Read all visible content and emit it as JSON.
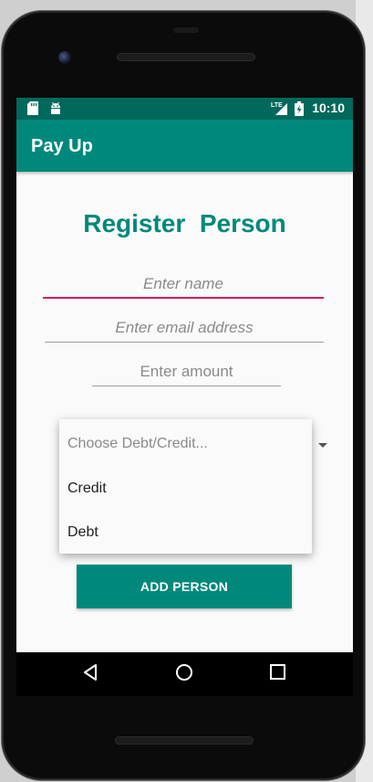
{
  "app": {
    "title": "Pay Up"
  },
  "status_bar": {
    "time": "10:10",
    "network": "LTE",
    "icons": [
      "sd-card-icon",
      "android-icon",
      "signal-icon",
      "battery-charging-icon"
    ]
  },
  "form": {
    "heading": "Register  Person",
    "name_placeholder": "Enter name",
    "email_placeholder": "Enter email address",
    "amount_placeholder": "Enter amount"
  },
  "dropdown": {
    "hint": "Choose Debt/Credit...",
    "options": [
      "Credit",
      "Debt"
    ]
  },
  "actions": {
    "add_person_label": "ADD PERSON"
  },
  "nav": {
    "buttons": [
      "back-icon",
      "home-icon",
      "recents-icon"
    ]
  },
  "colors": {
    "status_bar": "#00695c",
    "primary": "#00897b",
    "accent": "#d81b60"
  }
}
